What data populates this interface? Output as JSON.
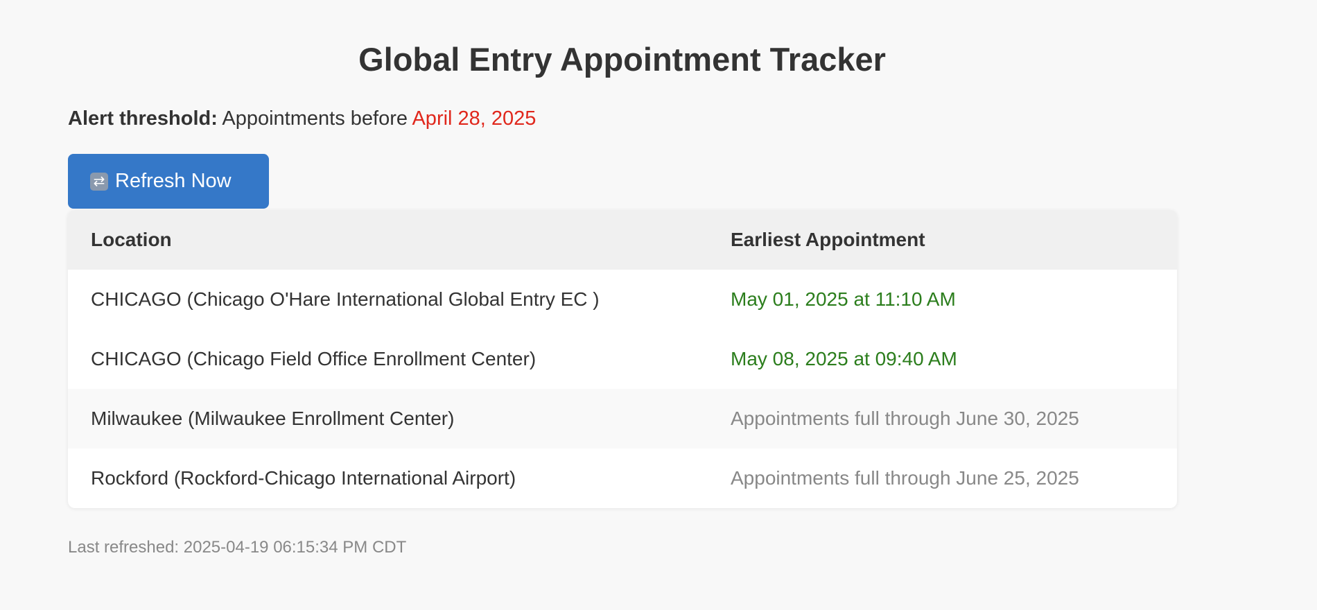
{
  "title": "Global Entry Appointment Tracker",
  "alert": {
    "label": "Alert threshold:",
    "text": "Appointments before",
    "date": "April 28, 2025"
  },
  "refresh_button": {
    "icon": "repeat-icon",
    "icon_glyph": "⇄",
    "label": "Refresh Now"
  },
  "table": {
    "headers": [
      "Location",
      "Earliest Appointment"
    ],
    "rows": [
      {
        "location": "CHICAGO (Chicago O'Hare International Global Entry EC )",
        "appointment": "May 01, 2025 at 11:10 AM",
        "status": "available"
      },
      {
        "location": "CHICAGO (Chicago Field Office Enrollment Center)",
        "appointment": "May 08, 2025 at 09:40 AM",
        "status": "available"
      },
      {
        "location": "Milwaukee (Milwaukee Enrollment Center)",
        "appointment": "Appointments full through June 30, 2025",
        "status": "full"
      },
      {
        "location": "Rockford (Rockford-Chicago International Airport)",
        "appointment": "Appointments full through June 25, 2025",
        "status": "full"
      }
    ]
  },
  "footer": "Last refreshed: 2025-04-19 06:15:34 PM CDT",
  "colors": {
    "accent": "#3578c8",
    "alert_date": "#e0271c",
    "available": "#2b7d1c",
    "full": "#888888"
  }
}
